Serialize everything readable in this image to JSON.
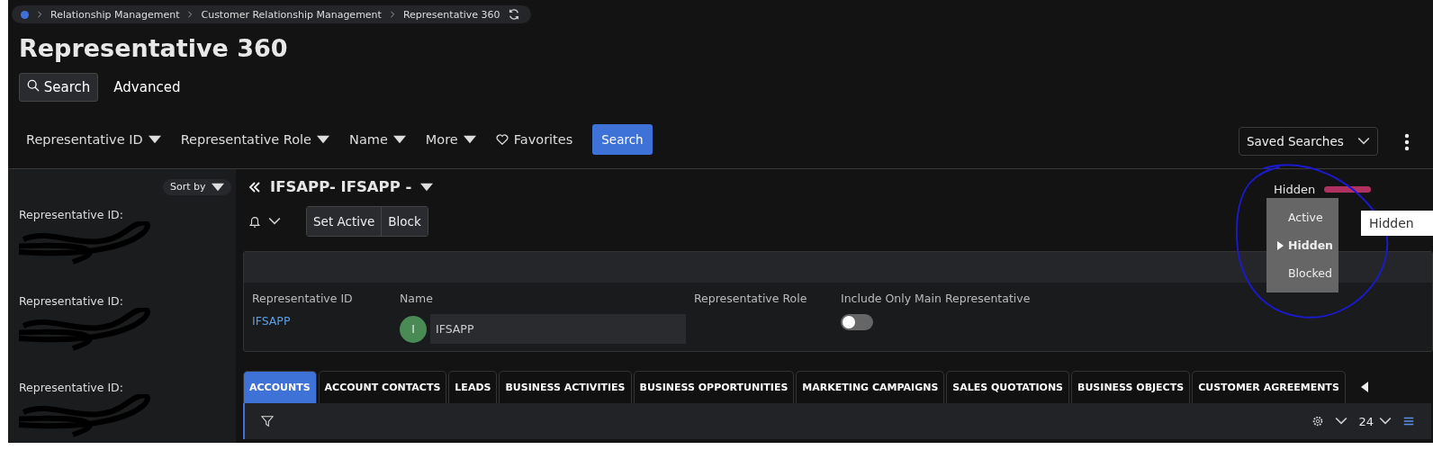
{
  "breadcrumb": {
    "items": [
      "Relationship Management",
      "Customer Relationship Management",
      "Representative 360"
    ]
  },
  "page_title": "Representative 360",
  "search_modes": [
    {
      "label": "Search",
      "selected": true
    },
    {
      "label": "Advanced",
      "selected": false
    }
  ],
  "filters": [
    {
      "label": "Representative ID",
      "kind": "dropdown"
    },
    {
      "label": "Representative Role",
      "kind": "dropdown"
    },
    {
      "label": "Name",
      "kind": "dropdown"
    },
    {
      "label": "More",
      "kind": "dropdown"
    },
    {
      "label": "Favorites",
      "kind": "favorites"
    }
  ],
  "search_button": "Search",
  "saved_searches": "Saved Searches",
  "sidebar": {
    "sort_label": "Sort by",
    "items": [
      {
        "label": "Representative ID:"
      },
      {
        "label": "Representative ID:"
      },
      {
        "label": "Representative ID:"
      }
    ]
  },
  "record": {
    "title": "IFSAPP- IFSAPP -",
    "actions": [
      "Set Active",
      "Block"
    ],
    "status": "Hidden",
    "status_menu": [
      {
        "label": "Active",
        "selected": false
      },
      {
        "label": "Hidden",
        "selected": true
      },
      {
        "label": "Blocked",
        "selected": false
      }
    ],
    "tooltip": "Hidden",
    "fields": [
      {
        "kind": "link",
        "label": "Representative ID",
        "value": "IFSAPP"
      },
      {
        "kind": "avatar",
        "label": "Name",
        "initial": "I",
        "value": "IFSAPP"
      },
      {
        "kind": "empty",
        "label": "Representative Role"
      },
      {
        "kind": "toggle",
        "label": "Include Only Main Representative",
        "on": false
      }
    ]
  },
  "tabs": [
    {
      "label": "ACCOUNTS",
      "selected": true
    },
    {
      "label": "ACCOUNT CONTACTS",
      "selected": false
    },
    {
      "label": "LEADS",
      "selected": false
    },
    {
      "label": "BUSINESS ACTIVITIES",
      "selected": false
    },
    {
      "label": "BUSINESS OPPORTUNITIES",
      "selected": false
    },
    {
      "label": "MARKETING CAMPAIGNS",
      "selected": false
    },
    {
      "label": "SALES QUOTATIONS",
      "selected": false
    },
    {
      "label": "BUSINESS OBJECTS",
      "selected": false
    },
    {
      "label": "CUSTOMER AGREEMENTS",
      "selected": false
    }
  ],
  "table_toolbar": {
    "page_size": "24"
  }
}
